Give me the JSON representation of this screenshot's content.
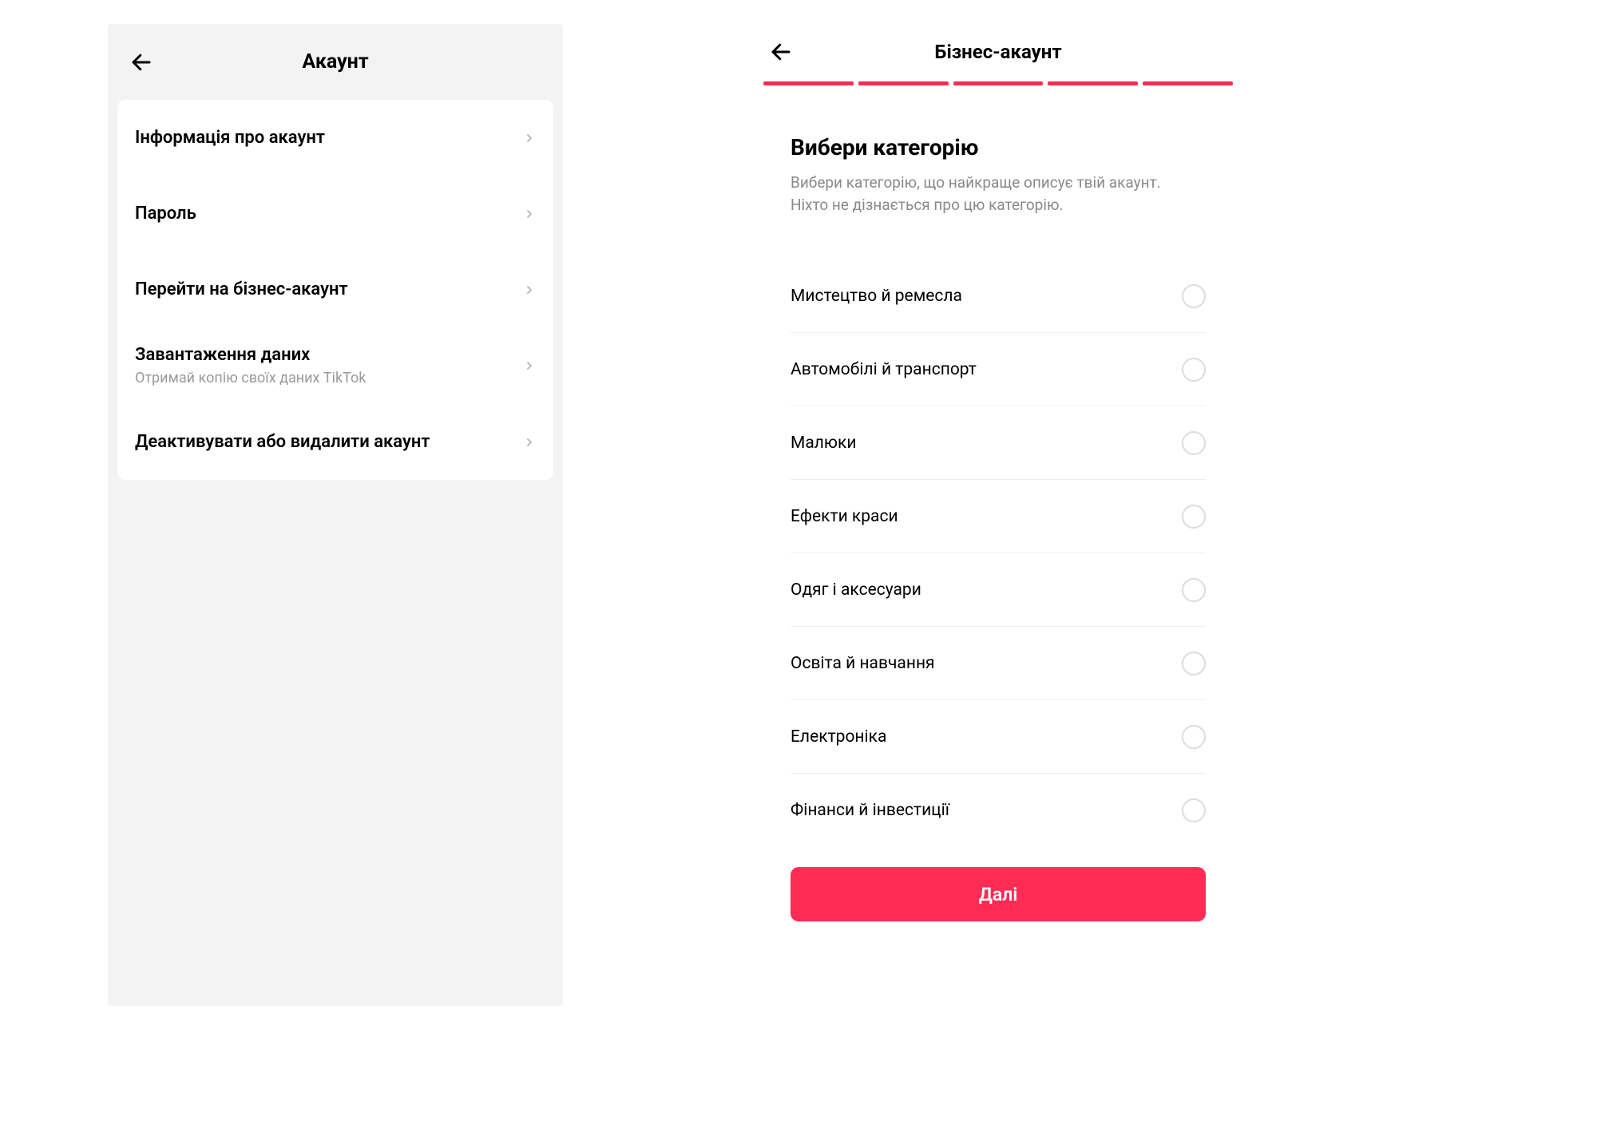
{
  "left": {
    "title": "Акаунт",
    "items": [
      {
        "label": "Інформація про акаунт",
        "sub": ""
      },
      {
        "label": "Пароль",
        "sub": ""
      },
      {
        "label": "Перейти на бізнес-акаунт",
        "sub": ""
      },
      {
        "label": "Завантаження даних",
        "sub": "Отримай копію своїх даних TikTok"
      },
      {
        "label": "Деактивувати або видалити акаунт",
        "sub": ""
      }
    ]
  },
  "right": {
    "title": "Бізнес-акаунт",
    "progress_segments": 5,
    "heading": "Вибери категорію",
    "description": "Вибери категорію, що найкраще описує твій акаунт. Ніхто не дізнається про цю категорію.",
    "categories": [
      "Мистецтво й ремесла",
      "Автомобілі й транспорт",
      "Малюки",
      "Ефекти краси",
      "Одяг і аксесуари",
      "Освіта й навчання",
      "Електроніка",
      "Фінанси й інвестиції"
    ],
    "next_label": "Далі"
  },
  "colors": {
    "accent": "#fe2c55"
  }
}
